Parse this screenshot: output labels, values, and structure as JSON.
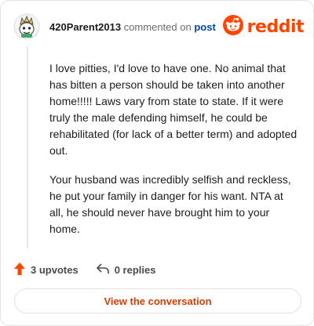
{
  "header": {
    "username": "420Parent2013",
    "commented_text": "commented on",
    "post_link": "post",
    "logo_text": "reddit"
  },
  "comment": {
    "paragraphs": [
      "I love pitties, I'd love to have one. No animal that has bitten a person should be taken into another home!!!!! Laws vary from state to state. If it were truly the male defending himself, he could be rehabilitated (for lack of a better term) and adopted out.",
      "Your husband was incredibly selfish and reckless, he put your family in danger for his want. NTA at all, he should never have brought him to your home."
    ]
  },
  "actions": {
    "upvotes": "3 upvotes",
    "replies": "0 replies"
  },
  "footer": {
    "button_label": "View the conversation"
  },
  "colors": {
    "brand": "#ff4500",
    "link": "#0045ac",
    "button_text": "#d93a00",
    "upvote": "#ff4500"
  },
  "icons": [
    "avatar-icon",
    "reddit-logo-icon",
    "upvote-arrow-icon",
    "reply-arrow-icon"
  ]
}
